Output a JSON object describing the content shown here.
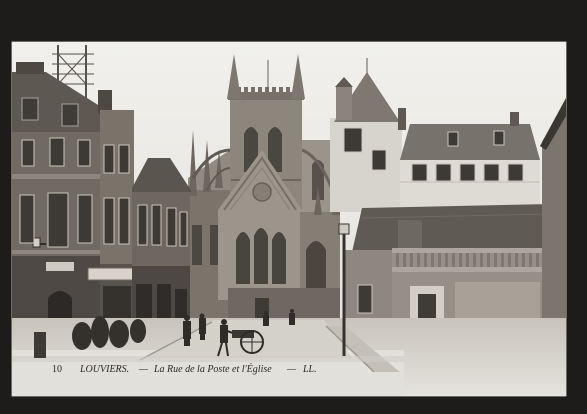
{
  "caption": {
    "number": "10",
    "town": "LOUVIERS.",
    "dash_before_title": "—",
    "title": "La Rue de la Poste et l'Église",
    "dash_before_publisher": "—",
    "publisher": "LL."
  },
  "colors": {
    "scan_background": "#1d1c1b",
    "paper": "#e4e2dc",
    "ink": "#2b2825"
  }
}
